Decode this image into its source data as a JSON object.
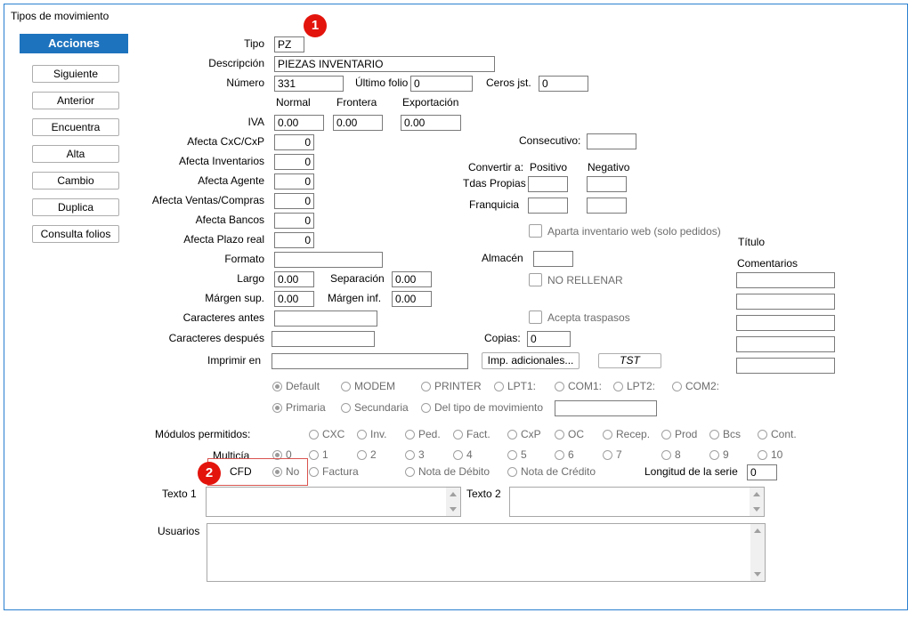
{
  "window": {
    "title": "Tipos de movimiento"
  },
  "sidebar": {
    "header": "Acciones",
    "buttons": [
      "Siguiente",
      "Anterior",
      "Encuentra",
      "Alta",
      "Cambio",
      "Duplica",
      "Consulta folios"
    ]
  },
  "markers": [
    "1",
    "2"
  ],
  "form": {
    "tipo": {
      "label": "Tipo",
      "value": "PZ"
    },
    "descripcion": {
      "label": "Descripción",
      "value": "PIEZAS INVENTARIO"
    },
    "numero": {
      "label": "Número",
      "value": "331"
    },
    "ultimo_folio": {
      "label": "Último folio",
      "value": "0"
    },
    "ceros": {
      "label": "Ceros jst.",
      "value": "0"
    },
    "tax_headers": [
      "Normal",
      "Frontera",
      "Exportación"
    ],
    "iva": {
      "label": "IVA",
      "normal": "0.00",
      "frontera": "0.00",
      "exportacion": "0.00"
    },
    "afecta": [
      {
        "label": "Afecta  CxC/CxP",
        "value": "0"
      },
      {
        "label": "Afecta  Inventarios",
        "value": "0"
      },
      {
        "label": "Afecta  Agente",
        "value": "0"
      },
      {
        "label": "Afecta  Ventas/Compras",
        "value": "0"
      },
      {
        "label": "Afecta  Bancos",
        "value": "0"
      },
      {
        "label": "Afecta  Plazo real",
        "value": "0"
      }
    ],
    "formato": {
      "label": "Formato",
      "value": ""
    },
    "largo": {
      "label": "Largo",
      "value": "0.00"
    },
    "separacion": {
      "label": "Separación",
      "value": "0.00"
    },
    "margen_sup": {
      "label": "Márgen sup.",
      "value": "0.00"
    },
    "margen_inf": {
      "label": "Márgen inf.",
      "value": "0.00"
    },
    "caracteres_antes": {
      "label": "Caracteres antes",
      "value": ""
    },
    "caracteres_despues": {
      "label": "Caracteres después",
      "value": ""
    },
    "imprimir_en": {
      "label": "Imprimir en",
      "value": ""
    },
    "imp_adicionales": "Imp. adicionales...",
    "tst": "TST",
    "consecutivo": {
      "label": "Consecutivo:",
      "value": ""
    },
    "convertir": {
      "label": "Convertir a:",
      "positivo": "Positivo",
      "negativo": "Negativo"
    },
    "tdas_propias": {
      "label": "Tdas Propias"
    },
    "franquicia": {
      "label": "Franquicia"
    },
    "aparta_web": "Aparta inventario web (solo pedidos)",
    "almacen": {
      "label": "Almacén",
      "value": ""
    },
    "no_rellenar": "NO RELLENAR",
    "acepta_traspasos": "Acepta traspasos",
    "copias": {
      "label": "Copias:",
      "value": "0"
    },
    "titulo": "Título",
    "comentarios": "Comentarios",
    "port_options": [
      "Default",
      "MODEM",
      "PRINTER",
      "LPT1:",
      "COM1:",
      "LPT2:",
      "COM2:"
    ],
    "port_selected": "Default",
    "type_options": [
      "Primaria",
      "Secundaria",
      "Del tipo de movimiento"
    ],
    "type_selected": "Primaria",
    "modulos": {
      "label": "Módulos permitidos:",
      "options": [
        "CXC",
        "Inv.",
        "Ped.",
        "Fact.",
        "CxP",
        "OC",
        "Recep.",
        "Prod",
        "Bcs",
        "Cont."
      ]
    },
    "multicia": {
      "label": "Multicía",
      "options": [
        "0",
        "1",
        "2",
        "3",
        "4",
        "5",
        "6",
        "7",
        "8",
        "9",
        "10"
      ],
      "selected": "0"
    },
    "cfd": {
      "label": "CFD",
      "options": [
        "No",
        "Factura",
        "Nota de Débito",
        "Nota de Crédito"
      ],
      "selected": "No"
    },
    "longitud_serie": {
      "label": "Longitud de la serie",
      "value": "0"
    },
    "texto1": {
      "label": "Texto 1"
    },
    "texto2": {
      "label": "Texto 2"
    },
    "usuarios": {
      "label": "Usuarios"
    }
  }
}
